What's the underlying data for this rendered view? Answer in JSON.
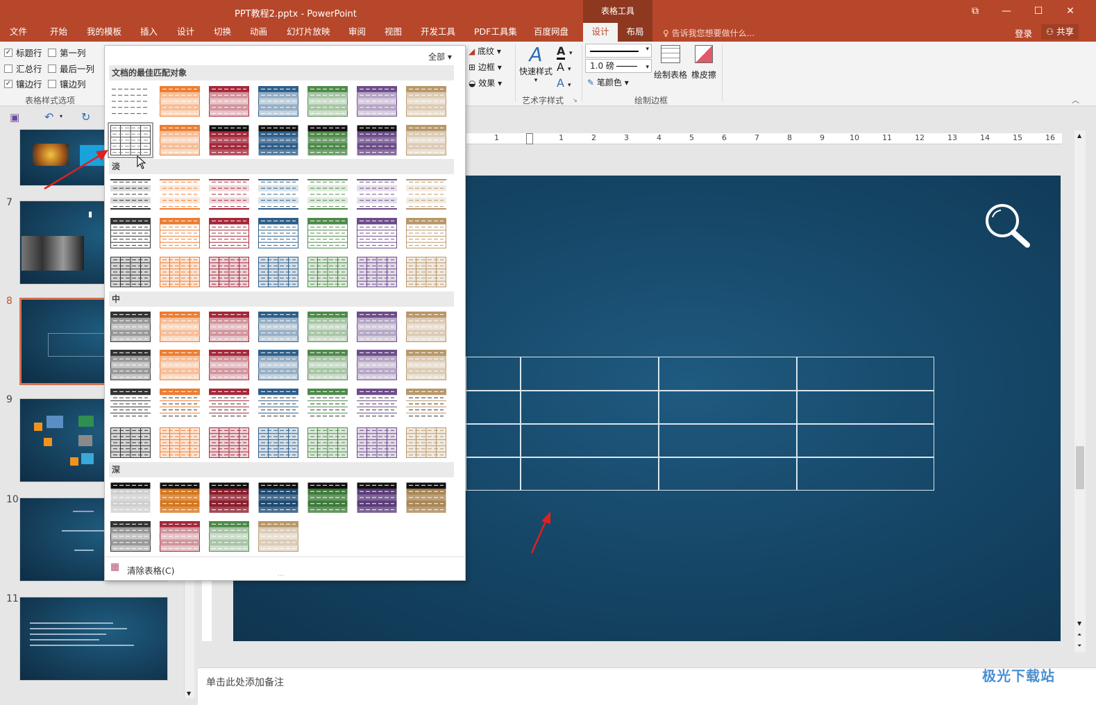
{
  "window": {
    "title": "PPT教程2.pptx - PowerPoint",
    "context_group": "表格工具",
    "buttons": [
      "⧉",
      "—",
      "☐",
      "✕"
    ]
  },
  "tabs": [
    {
      "label": "文件"
    },
    {
      "label": "开始"
    },
    {
      "label": "我的模板"
    },
    {
      "label": "插入"
    },
    {
      "label": "设计"
    },
    {
      "label": "切换"
    },
    {
      "label": "动画"
    },
    {
      "label": "幻灯片放映"
    },
    {
      "label": "审阅"
    },
    {
      "label": "视图"
    },
    {
      "label": "开发工具"
    },
    {
      "label": "PDF工具集"
    },
    {
      "label": "百度网盘"
    },
    {
      "label": "设计"
    },
    {
      "label": "布局"
    }
  ],
  "tellme": "告诉我您想要做什么...",
  "account": {
    "login": "登录",
    "share": "共享"
  },
  "ribbon": {
    "options": {
      "header_row": "标题行",
      "first_column": "第一列",
      "total_row": "汇总行",
      "last_column": "最后一列",
      "banded_rows": "镶边行",
      "banded_columns": "镶边列",
      "group_label": "表格样式选项"
    },
    "shading": "底纹",
    "borders": "边框",
    "effects": "效果",
    "quick_styles": "快速样式",
    "wordart_label": "艺术字样式",
    "pen_weight": "1.0 磅",
    "pen_color": "笔颜色",
    "draw_table": "绘制表格",
    "eraser": "橡皮擦",
    "draw_borders_label": "绘制边框"
  },
  "gallery": {
    "filter": "全部",
    "sections": [
      "文档的最佳匹配对象",
      "淡",
      "中",
      "深"
    ],
    "clear": "清除表格(C)",
    "colors": [
      "#333333",
      "#ed7d31",
      "#a5283a",
      "#2e5f8a",
      "#4e8a4a",
      "#6d4c8a",
      "#b8976a"
    ]
  },
  "slides": {
    "numbers": [
      "7",
      "8",
      "9",
      "10",
      "11"
    ]
  },
  "ruler": [
    "1",
    "1",
    "2",
    "3",
    "4",
    "5",
    "6",
    "7",
    "8",
    "9",
    "10",
    "11",
    "12",
    "13",
    "14",
    "15",
    "16"
  ],
  "notes_placeholder": "单击此处添加备注",
  "watermark": "极光下载站"
}
